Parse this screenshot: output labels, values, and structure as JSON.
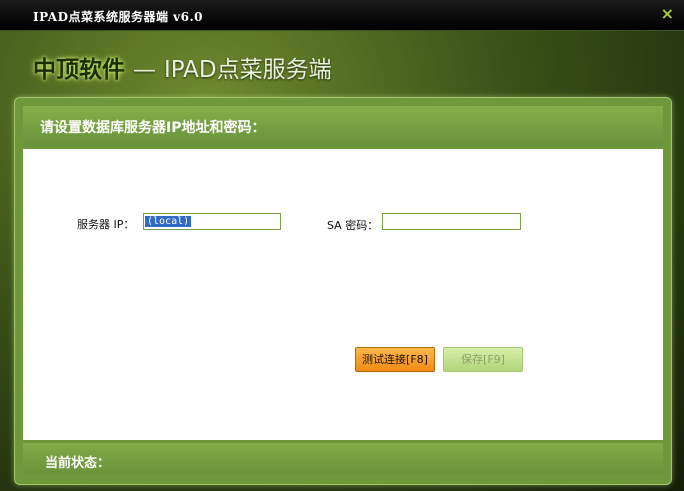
{
  "window": {
    "title": "IPAD点菜系统服务器端 v6.0",
    "close_glyph": "×"
  },
  "brand": {
    "company": "中顶软件",
    "separator": "—",
    "product": "IPAD点菜服务端"
  },
  "panel": {
    "header": "请设置数据库服务器IP地址和密码："
  },
  "form": {
    "server_ip_label": "服务器 IP：",
    "server_ip_value": "(local)",
    "sa_password_label": "SA 密码：",
    "sa_password_value": ""
  },
  "buttons": {
    "test_connection": "测试连接[F8]",
    "save": "保存[F9]",
    "save_enabled": false
  },
  "status": {
    "label": "当前状态："
  },
  "colors": {
    "accent_green": "#6f983a",
    "button_orange": "#f08a14",
    "selection_blue": "#316ac5"
  }
}
